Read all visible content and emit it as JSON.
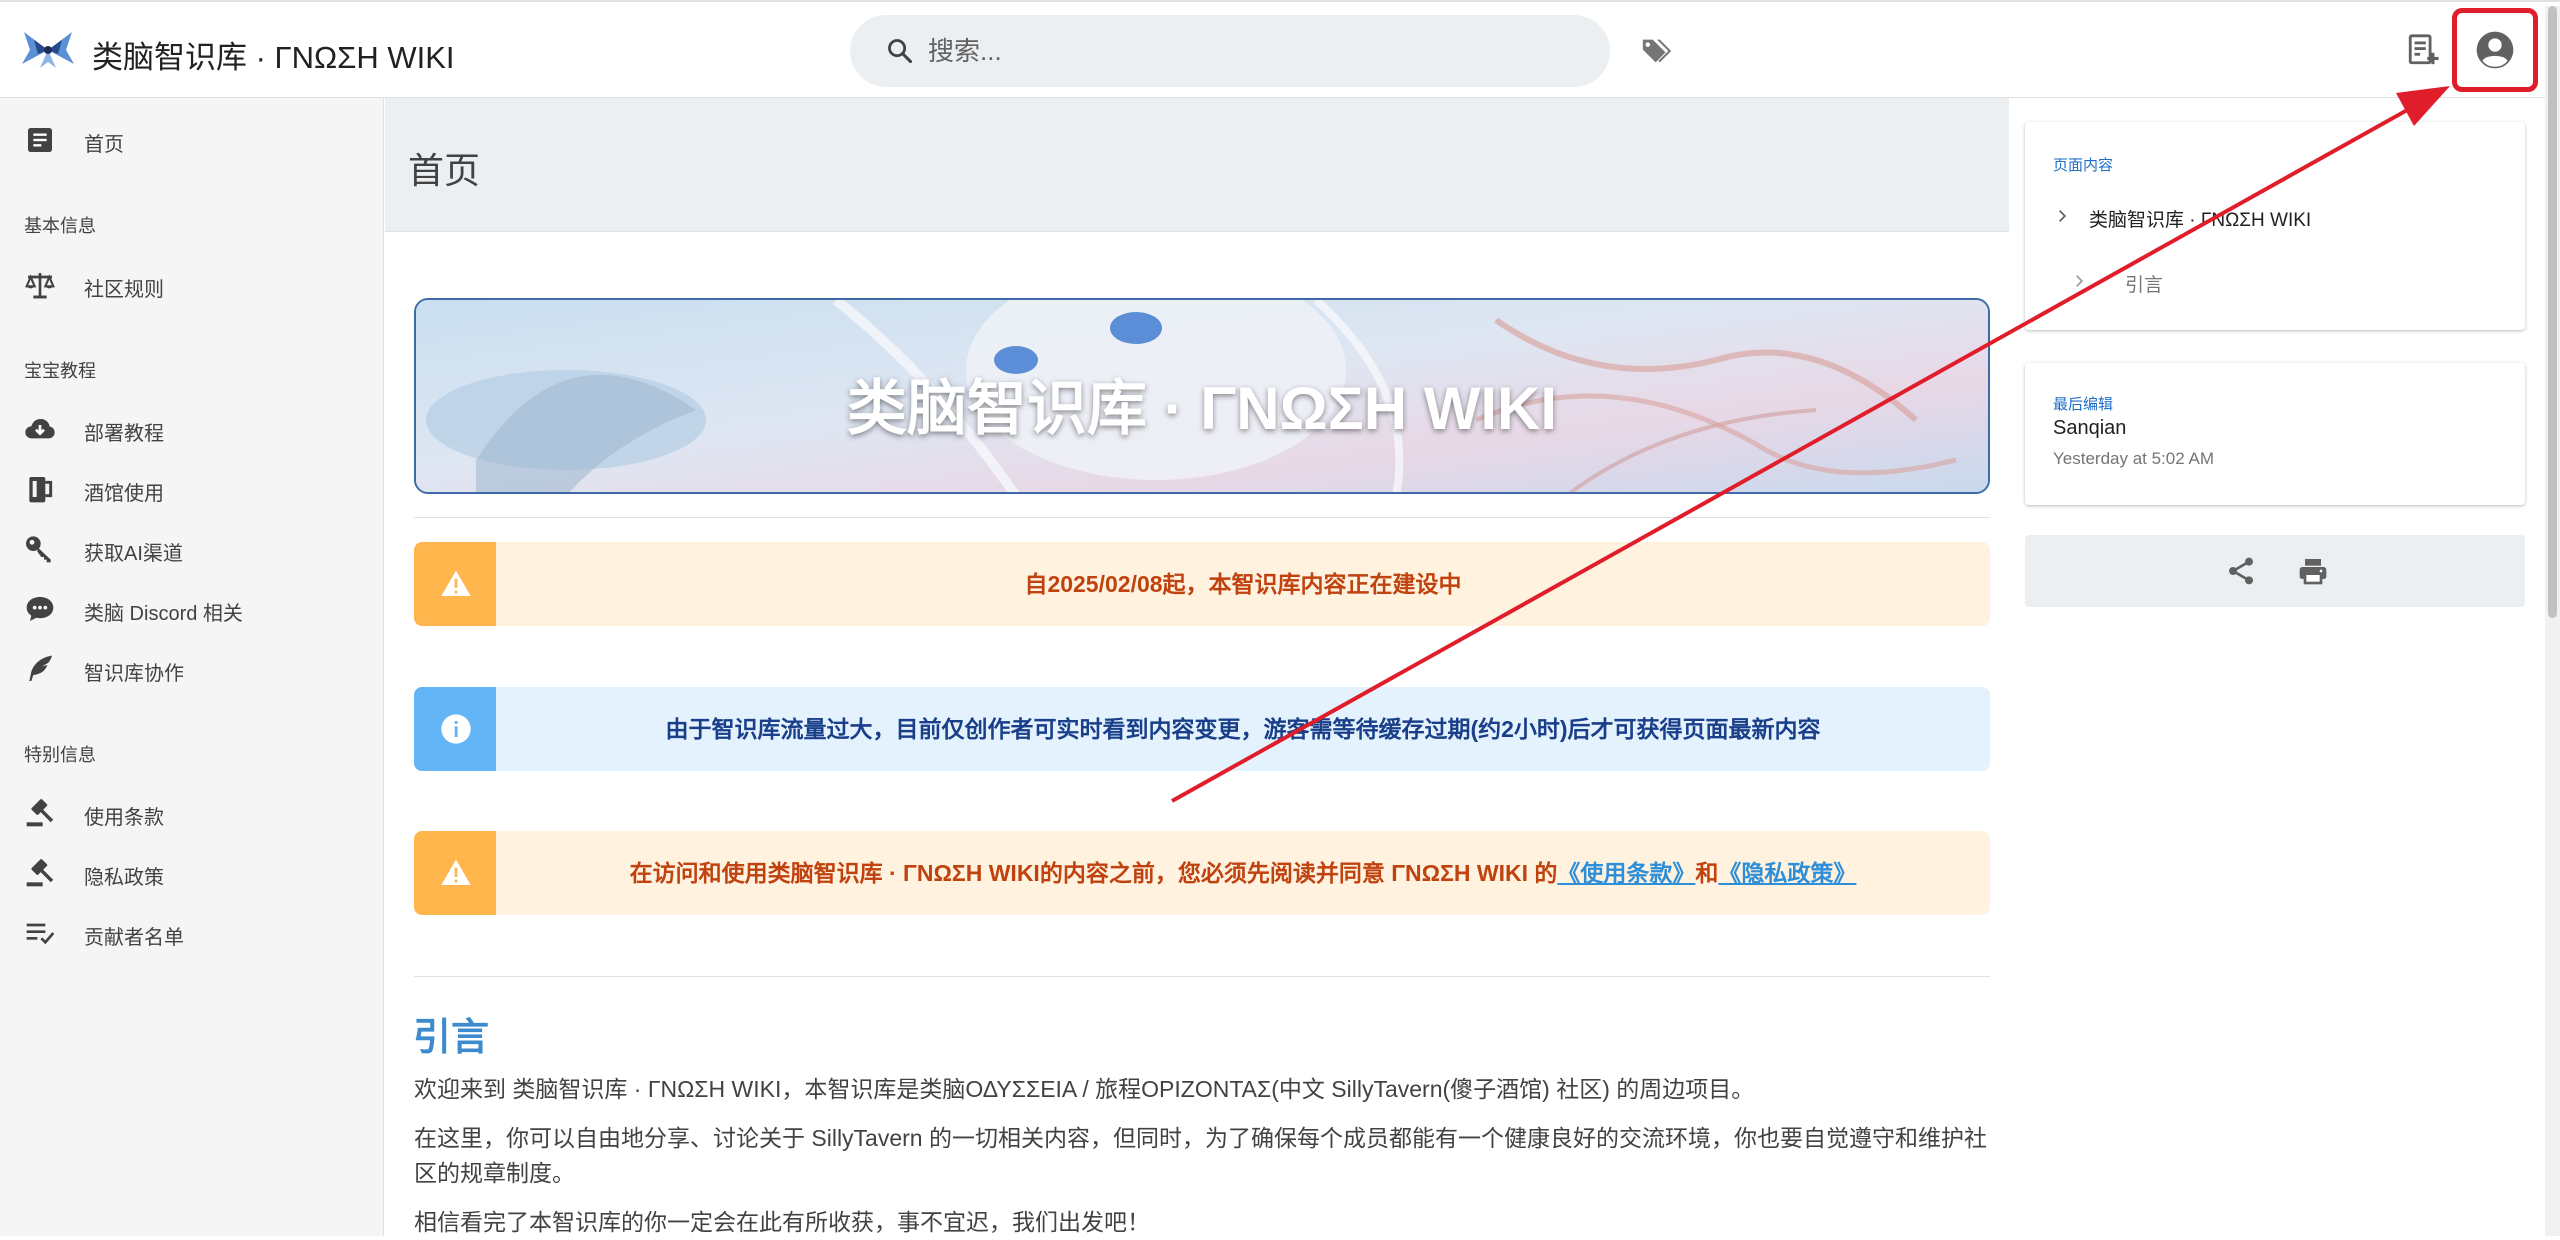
{
  "header": {
    "site_title": "类脑智识库 · ΓΝΩΣΗ WIKI",
    "search_placeholder": "搜索...",
    "icons": [
      "logo-icon",
      "search-icon",
      "tags-icon",
      "new-page-icon",
      "account-icon"
    ]
  },
  "sidebar": {
    "home": "首页",
    "sections": [
      {
        "header": "基本信息",
        "items": [
          "社区规则"
        ]
      },
      {
        "header": "宝宝教程",
        "items": [
          "部署教程",
          "酒馆使用",
          "获取AI渠道",
          "类脑 Discord 相关",
          "智识库协作"
        ]
      },
      {
        "header": "特别信息",
        "items": [
          "使用条款",
          "隐私政策",
          "贡献者名单"
        ]
      }
    ]
  },
  "page": {
    "title": "首页",
    "banner_title": "类脑智识库 · ΓΝΩΣΗ WIKI",
    "alerts": [
      {
        "type": "warning",
        "text": "自2025/02/08起，本智识库内容正在建设中"
      },
      {
        "type": "info",
        "text": "由于智识库流量过大，目前仅创作者可实时看到内容变更，游客需等待缓存过期(约2小时)后才可获得页面最新内容"
      },
      {
        "type": "warning",
        "text_before": "在访问和使用类脑智识库 · ΓΝΩΣΗ WIKI的内容之前，您必须先阅读并同意 ΓΝΩΣΗ WIKI 的",
        "link1": "《使用条款》",
        "between": "和",
        "link2": "《隐私政策》"
      }
    ],
    "section_title": "引言",
    "paragraphs": [
      "欢迎来到 类脑智识库 · ΓΝΩΣΗ WIKI，本智识库是类脑ΟΔΥΣΣΕΙΑ / 旅程ΟΡΙΖΟΝΤΑΣ(中文 SillyTavern(傻子酒馆) 社区) 的周边项目。",
      "在这里，你可以自由地分享、讨论关于 SillyTavern 的一切相关内容，但同时，为了确保每个成员都能有一个健康良好的交流环境，你也要自觉遵守和维护社区的规章制度。",
      "相信看完了本智识库的你一定会在此有所收获，事不宜迟，我们出发吧！"
    ]
  },
  "toc": {
    "label": "页面内容",
    "items": [
      "类脑智识库 · ΓΝΩΣΗ WIKI",
      "引言"
    ]
  },
  "last_edit": {
    "label": "最后编辑",
    "author": "Sanqian",
    "time": "Yesterday at 5:02 AM"
  },
  "actions": {
    "icons": [
      "share-icon",
      "print-icon"
    ]
  },
  "colors": {
    "highlight": "#e01e2b",
    "warning_bg": "#fff3e0",
    "warning_accent": "#ffb74d",
    "info_bg": "#e3f2fd",
    "info_accent": "#64b5f6",
    "link": "#2f8ed8",
    "section_title": "#3d8bcd"
  }
}
